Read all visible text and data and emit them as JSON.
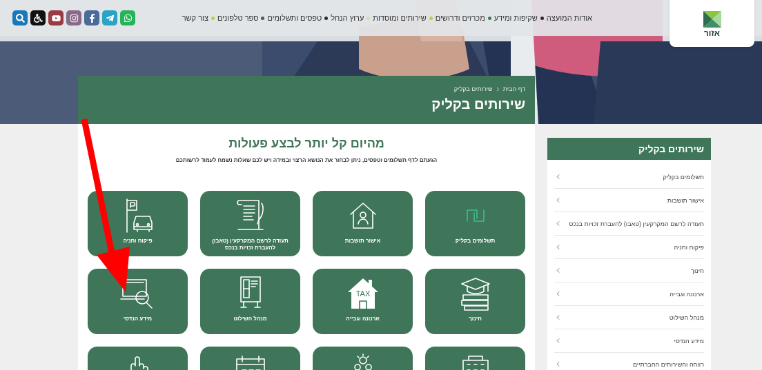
{
  "header": {
    "logo": {
      "text": "אזור"
    },
    "nav": [
      {
        "label": "אודות המועצה",
        "color": "#2b2b2b"
      },
      {
        "label": "שקיפות ומידע",
        "color": "#3f7a52"
      },
      {
        "label": "מכרזים ודרושים",
        "color": "#b7d334"
      },
      {
        "label": "שירותים ומוסדות",
        "color": "#cfe0a8"
      },
      {
        "label": "ערוץ הנחל",
        "color": "#2b2b2b"
      },
      {
        "label": "טפסים ותשלומים",
        "color": "#555555"
      },
      {
        "label": "ספר טלפונים",
        "color": "#b7d334"
      },
      {
        "label": "צור קשר"
      }
    ],
    "social": [
      {
        "kind": "search",
        "color": "#1a78b8"
      },
      {
        "kind": "accessibility",
        "color": "#111111"
      },
      {
        "kind": "youtube",
        "color": "#9a3a42"
      },
      {
        "kind": "instagram",
        "color": "#8a6a8a"
      },
      {
        "kind": "facebook",
        "color": "#4a6a9a"
      },
      {
        "kind": "telegram",
        "color": "#2aa3c4"
      },
      {
        "kind": "whatsapp",
        "color": "#25b45a"
      }
    ]
  },
  "page": {
    "breadcrumb": [
      "דף הבית",
      "שירותים בקליק"
    ],
    "title": "שירותים בקליק",
    "heading": "מהיום קל יותר לבצע פעולות",
    "intro": "הגעתם לדף תשלומים וטפסים, ניתן לבחור את הנושא הרצוי ובמידה ויש לכם שאלות נשמח לעמוד לרשותכם",
    "tiles": [
      {
        "kind": "shekel",
        "label": "תשלומים בקליק"
      },
      {
        "kind": "house-person",
        "label": "אישור תושבות"
      },
      {
        "kind": "scroll",
        "label": "תעודה לרשם המקרקעין (טאבו) להעברת זכויות בנכס"
      },
      {
        "kind": "parking",
        "label": "פיקוח וחניה"
      },
      {
        "kind": "books",
        "label": "חינוך"
      },
      {
        "kind": "tax-house",
        "label": "ארנונה וגבייה",
        "icon_text": "TAX"
      },
      {
        "kind": "board",
        "label": "מנהל השילוט"
      },
      {
        "kind": "laptop-search",
        "label": "מידע הנדסי"
      },
      {
        "kind": "building"
      },
      {
        "kind": "people"
      },
      {
        "kind": "calendar"
      },
      {
        "kind": "hand"
      }
    ]
  },
  "sidebar": {
    "title": "שירותים בקליק",
    "items": [
      "תשלומים בקליק",
      "אישור תושבות",
      "תעודה לרשם המקרקעין (טאבו) להעברת זכויות בנכס",
      "פיקוח וחניה",
      "חינוך",
      "ארנונה וגבייה",
      "מנהל השילוט",
      "מידע הנדסי",
      "רווחה והשירותים החברתיים"
    ]
  }
}
